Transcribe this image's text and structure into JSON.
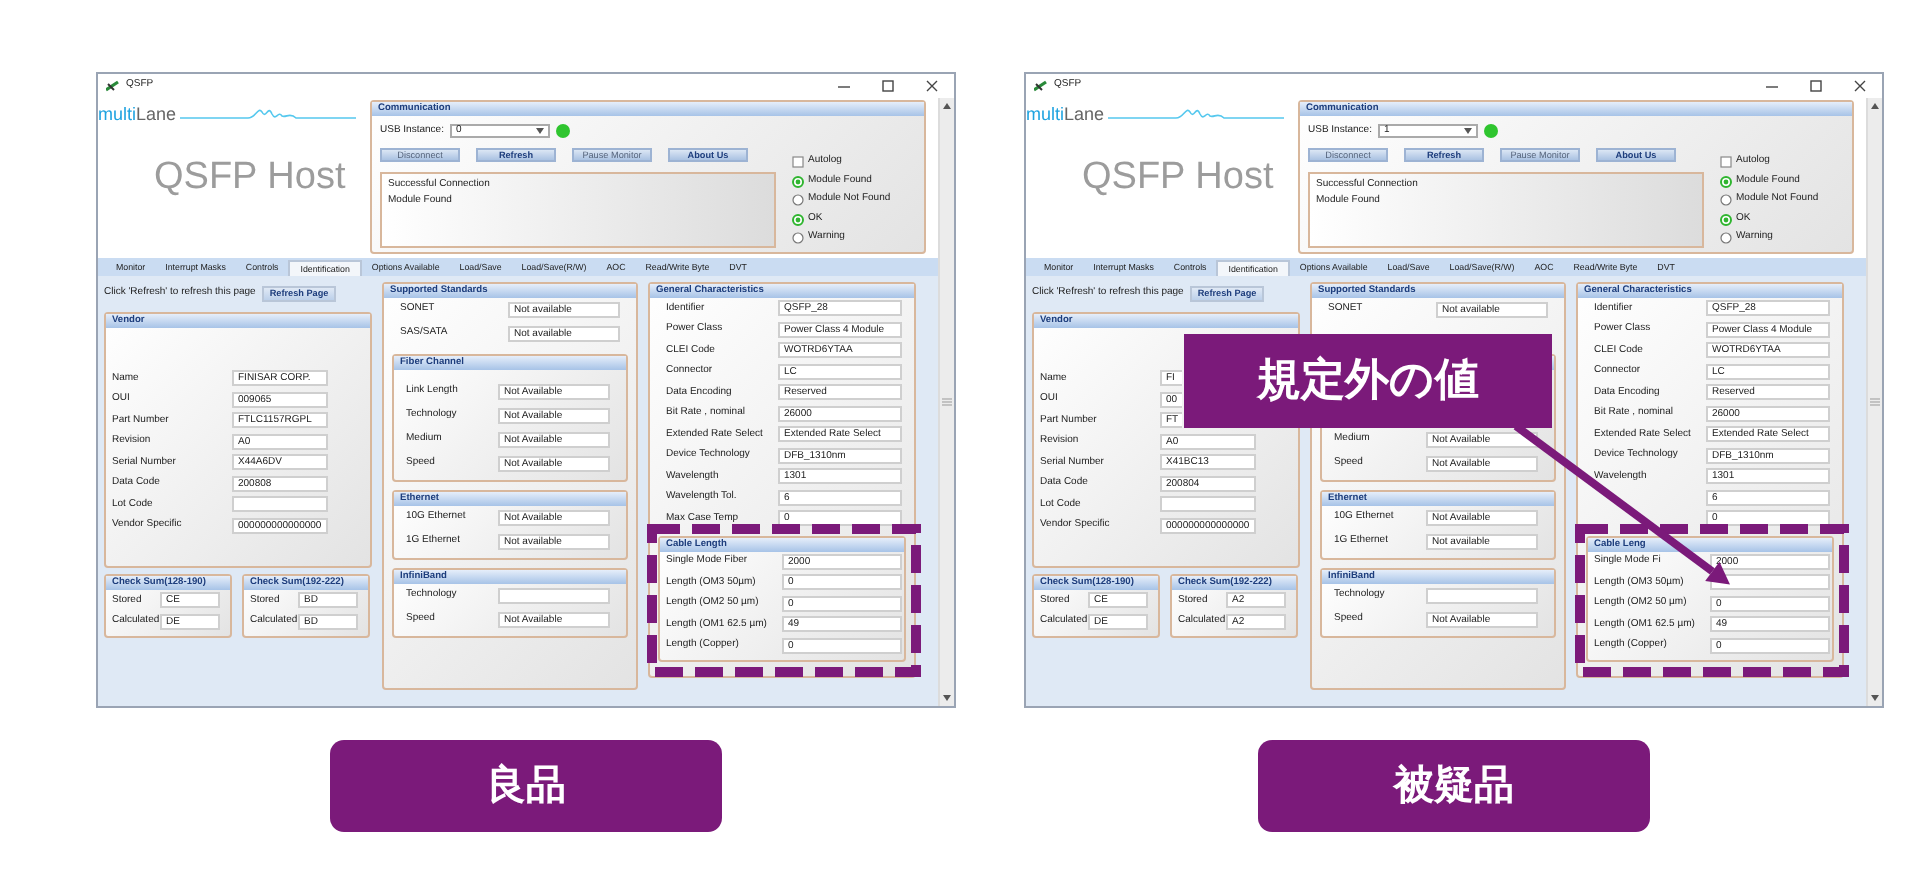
{
  "panels": [
    {
      "window": {
        "title": "QSFP"
      },
      "logo": {
        "prefix": "multi",
        "suffix": "Lane"
      },
      "app_title": "QSFP Host",
      "communication": {
        "title": "Communication",
        "usb_label": "USB Instance:",
        "usb_value": "0",
        "connected": true,
        "buttons": [
          {
            "label": "Disconnect",
            "disabled": true
          },
          {
            "label": "Refresh",
            "disabled": false
          },
          {
            "label": "Pause Monitor",
            "disabled": true
          },
          {
            "label": "About Us",
            "disabled": false
          }
        ],
        "log": [
          "Successful Connection",
          "Module Found"
        ],
        "autolog": {
          "label": "Autolog",
          "checked": false
        },
        "radios": [
          {
            "label": "Module Found",
            "selected": true
          },
          {
            "label": "Module Not Found",
            "selected": false
          },
          {
            "label": "OK",
            "selected": true
          },
          {
            "label": "Warning",
            "selected": false
          }
        ]
      },
      "tabs": [
        {
          "label": "Monitor",
          "selected": false
        },
        {
          "label": "Interrupt Masks",
          "selected": false
        },
        {
          "label": "Controls",
          "selected": false
        },
        {
          "label": "Identification",
          "selected": true
        },
        {
          "label": "Options Available",
          "selected": false
        },
        {
          "label": "Load/Save",
          "selected": false
        },
        {
          "label": "Load/Save(R/W)",
          "selected": false
        },
        {
          "label": "AOC",
          "selected": false
        },
        {
          "label": "Read/Write Byte",
          "selected": false
        },
        {
          "label": "DVT",
          "selected": false
        }
      ],
      "refresh_hint": "Click 'Refresh' to refresh this page",
      "refresh_button": "Refresh Page",
      "vendor": {
        "title": "Vendor",
        "fields": [
          {
            "label": "Name",
            "value": "FINISAR CORP."
          },
          {
            "label": "OUI",
            "value": "009065"
          },
          {
            "label": "Part Number",
            "value": "FTLC1157RGPL"
          },
          {
            "label": "Revision",
            "value": "A0"
          },
          {
            "label": "Serial Number",
            "value": "X44A6DV"
          },
          {
            "label": "Data Code",
            "value": "200808"
          },
          {
            "label": "Lot Code"
          },
          {
            "label": "Vendor Specific",
            "value": "000000000000000"
          }
        ]
      },
      "checksums": [
        {
          "title": "Check Sum(128-190)",
          "fields": [
            {
              "label": "Stored",
              "value": "CE"
            },
            {
              "label": "Calculated",
              "value": "DE"
            }
          ]
        },
        {
          "title": "Check Sum(192-222)",
          "fields": [
            {
              "label": "Stored",
              "value": "BD"
            },
            {
              "label": "Calculated",
              "value": "BD"
            }
          ]
        }
      ],
      "standards": {
        "title": "Supported Standards",
        "fields": [
          {
            "label": "SONET",
            "value": "Not available"
          },
          {
            "label": "SAS/SATA",
            "value": "Not available"
          }
        ],
        "groups": [
          {
            "title": "Fiber Channel",
            "fields": [
              {
                "label": "Link Length",
                "value": "Not Available"
              },
              {
                "label": "Technology",
                "value": "Not Available"
              },
              {
                "label": "Medium",
                "value": "Not Available"
              },
              {
                "label": "Speed",
                "value": "Not Available"
              }
            ]
          },
          {
            "title": "Ethernet",
            "fields": [
              {
                "label": "10G Ethernet",
                "value": "Not Available"
              },
              {
                "label": "1G Ethernet",
                "value": "Not available"
              }
            ]
          },
          {
            "title": "InfiniBand",
            "fields": [
              {
                "label": "Technology"
              },
              {
                "label": "Speed",
                "value": "Not Available"
              }
            ]
          }
        ]
      },
      "general": {
        "title": "General Characteristics",
        "fields": [
          {
            "label": "Identifier",
            "value": "QSFP_28"
          },
          {
            "label": "Power Class",
            "value": "Power Class 4 Module"
          },
          {
            "label": "CLEI Code",
            "value": "WOTRD6YTAA"
          },
          {
            "label": "Connector",
            "value": "LC"
          },
          {
            "label": "Data Encoding",
            "value": "Reserved"
          },
          {
            "label": "Bit Rate , nominal",
            "value": "26000"
          },
          {
            "label": "Extended Rate Select",
            "value": "Extended Rate Select"
          },
          {
            "label": "Device Technology",
            "value": "DFB_1310nm"
          },
          {
            "label": "Wavelength",
            "value": "1301"
          },
          {
            "label": "Wavelength Tol.",
            "value": "6"
          },
          {
            "label": "Max Case Temp",
            "value": "0"
          }
        ],
        "cable": {
          "title": "Cable Length",
          "highlighted": true,
          "fields": [
            {
              "label": "Single Mode Fiber",
              "value": "2000"
            },
            {
              "label": "Length (OM3 50µm)",
              "value": "0"
            },
            {
              "label": "Length (OM2 50 µm)",
              "value": "0"
            },
            {
              "label": "Length (OM1 62.5 µm)",
              "value": "49"
            },
            {
              "label": "Length (Copper)",
              "value": "0"
            }
          ]
        }
      },
      "caption": "良品"
    },
    {
      "window": {
        "title": "QSFP"
      },
      "logo": {
        "prefix": "multi",
        "suffix": "Lane"
      },
      "app_title": "QSFP Host",
      "communication": {
        "title": "Communication",
        "usb_label": "USB Instance:",
        "usb_value": "1",
        "connected": true,
        "buttons": [
          {
            "label": "Disconnect",
            "disabled": true
          },
          {
            "label": "Refresh",
            "disabled": false
          },
          {
            "label": "Pause Monitor",
            "disabled": true
          },
          {
            "label": "About Us",
            "disabled": false
          }
        ],
        "log": [
          "Successful Connection",
          "Module Found"
        ],
        "autolog": {
          "label": "Autolog",
          "checked": false
        },
        "radios": [
          {
            "label": "Module Found",
            "selected": true
          },
          {
            "label": "Module Not Found",
            "selected": false
          },
          {
            "label": "OK",
            "selected": true
          },
          {
            "label": "Warning",
            "selected": false
          }
        ]
      },
      "tabs": [
        {
          "label": "Monitor",
          "selected": false
        },
        {
          "label": "Interrupt Masks",
          "selected": false
        },
        {
          "label": "Controls",
          "selected": false
        },
        {
          "label": "Identification",
          "selected": true
        },
        {
          "label": "Options Available",
          "selected": false
        },
        {
          "label": "Load/Save",
          "selected": false
        },
        {
          "label": "Load/Save(R/W)",
          "selected": false
        },
        {
          "label": "AOC",
          "selected": false
        },
        {
          "label": "Read/Write Byte",
          "selected": false
        },
        {
          "label": "DVT",
          "selected": false
        }
      ],
      "refresh_hint": "Click 'Refresh' to refresh this page",
      "refresh_button": "Refresh Page",
      "vendor": {
        "title": "Vendor",
        "fields": [
          {
            "label": "Name",
            "value": "FI",
            "covered": true
          },
          {
            "label": "OUI",
            "value": "00",
            "covered": true
          },
          {
            "label": "Part Number",
            "value": "FT",
            "covered": true
          },
          {
            "label": "Revision",
            "value": "A0"
          },
          {
            "label": "Serial Number",
            "value": "X41BC13"
          },
          {
            "label": "Data Code",
            "value": "200804"
          },
          {
            "label": "Lot Code"
          },
          {
            "label": "Vendor Specific",
            "value": "000000000000000"
          }
        ]
      },
      "checksums": [
        {
          "title": "Check Sum(128-190)",
          "fields": [
            {
              "label": "Stored",
              "value": "CE"
            },
            {
              "label": "Calculated",
              "value": "DE"
            }
          ]
        },
        {
          "title": "Check Sum(192-222)",
          "fields": [
            {
              "label": "Stored",
              "value": "A2"
            },
            {
              "label": "Calculated",
              "value": "A2"
            }
          ]
        }
      ],
      "standards": {
        "title": "Supported Standards",
        "fields": [
          {
            "label": "SONET",
            "value": "Not available"
          }
        ],
        "groups": [
          {
            "fields": [
              {
                "label": "Medium",
                "value": "Not Available"
              },
              {
                "label": "Speed",
                "value": "Not Available"
              }
            ]
          },
          {
            "title": "Ethernet",
            "fields": [
              {
                "label": "10G Ethernet",
                "value": "Not Available"
              },
              {
                "label": "1G Ethernet",
                "value": "Not available"
              }
            ]
          },
          {
            "title": "InfiniBand",
            "fields": [
              {
                "label": "Technology"
              },
              {
                "label": "Speed",
                "value": "Not Available"
              }
            ]
          }
        ]
      },
      "general": {
        "title": "General Characteristics",
        "fields": [
          {
            "label": "Identifier",
            "value": "QSFP_28"
          },
          {
            "label": "Power Class",
            "value": "Power Class 4 Module"
          },
          {
            "label": "CLEI Code",
            "value": "WOTRD6YTAA"
          },
          {
            "label": "Connector",
            "value": "LC"
          },
          {
            "label": "Data Encoding",
            "value": "Reserved"
          },
          {
            "label": "Bit Rate , nominal",
            "value": "26000"
          },
          {
            "label": "Extended Rate Select",
            "value": "Extended Rate Select"
          },
          {
            "label": "Device Technology",
            "value": "DFB_1310nm"
          },
          {
            "label": "Wavelength",
            "value": "1301"
          },
          {
            "value": "6"
          },
          {
            "value": "0"
          }
        ],
        "cable": {
          "title": "Cable Leng",
          "highlighted": true,
          "fields": [
            {
              "label": "Single Mode Fi",
              "value": "2000"
            },
            {
              "label": "Length (OM3 50µm)",
              "flagged": true
            },
            {
              "label": "Length (OM2 50 µm)",
              "value": "0"
            },
            {
              "label": "Length (OM1 62.5 µm)",
              "value": "49"
            },
            {
              "label": "Length (Copper)",
              "value": "0"
            }
          ]
        }
      },
      "callout": {
        "text": "規定外の値"
      },
      "caption": "被疑品"
    }
  ]
}
